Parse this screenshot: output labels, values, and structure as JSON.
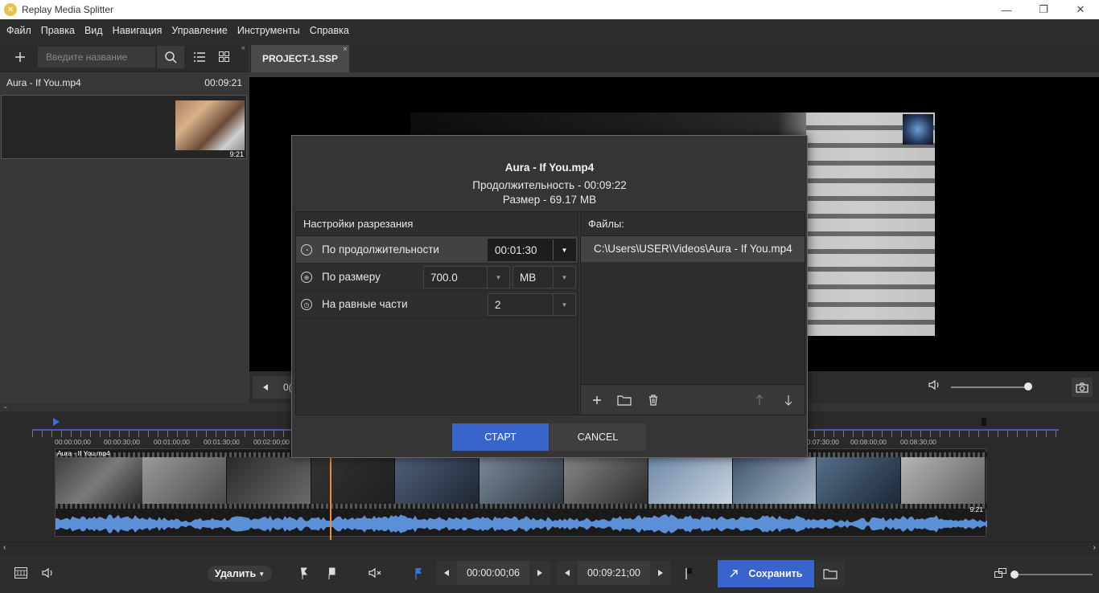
{
  "window": {
    "title": "Replay Media Splitter",
    "min_icon": "—",
    "max_icon": "❐",
    "close_icon": "✕"
  },
  "menu": [
    "Файл",
    "Правка",
    "Вид",
    "Навигация",
    "Управление",
    "Инструменты",
    "Справка"
  ],
  "library": {
    "search_placeholder": "Введите название",
    "file_name": "Aura - If You.mp4",
    "file_duration": "00:09:21",
    "thumb_duration": "9:21"
  },
  "tabs": {
    "project": "PROJECT-1.SSP",
    "close": "×"
  },
  "player": {
    "time_stub": "0("
  },
  "timeline": {
    "ruler_labels": [
      "00:00:00;00",
      "00:00:30;00",
      "00:01:00;00",
      "00:01:30;00",
      "00:02:00;00",
      "00:07:30;00",
      "00:08:00;00",
      "00:08:30;00"
    ],
    "track_label": "Aura - If You.mp4",
    "track_duration": "9:21"
  },
  "bottom": {
    "delete_label": "Удалить",
    "start_time": "00:00:00;06",
    "end_time": "00:09:21;00",
    "save_label": "Сохранить"
  },
  "dialog": {
    "filename": "Aura - If You.mp4",
    "duration": "Продолжительность - 00:09:22",
    "size": "Размер - 69.17 MB",
    "split_title": "Настройки разрезания",
    "by_duration_label": "По продолжительности",
    "by_duration_value": "00:01:30",
    "by_size_label": "По размеру",
    "by_size_value": "700.0",
    "by_size_unit": "MB",
    "equal_parts_label": "На равные части",
    "equal_parts_value": "2",
    "files_title": "Файлы:",
    "file_path": "C:\\Users\\USER\\Videos\\Aura - If You.mp4",
    "start_label": "СТАРТ",
    "cancel_label": "CANCEL"
  },
  "colors": {
    "accent": "#3864cc",
    "playhead": "#f08a3c",
    "waveform": "#5b8fd6"
  }
}
